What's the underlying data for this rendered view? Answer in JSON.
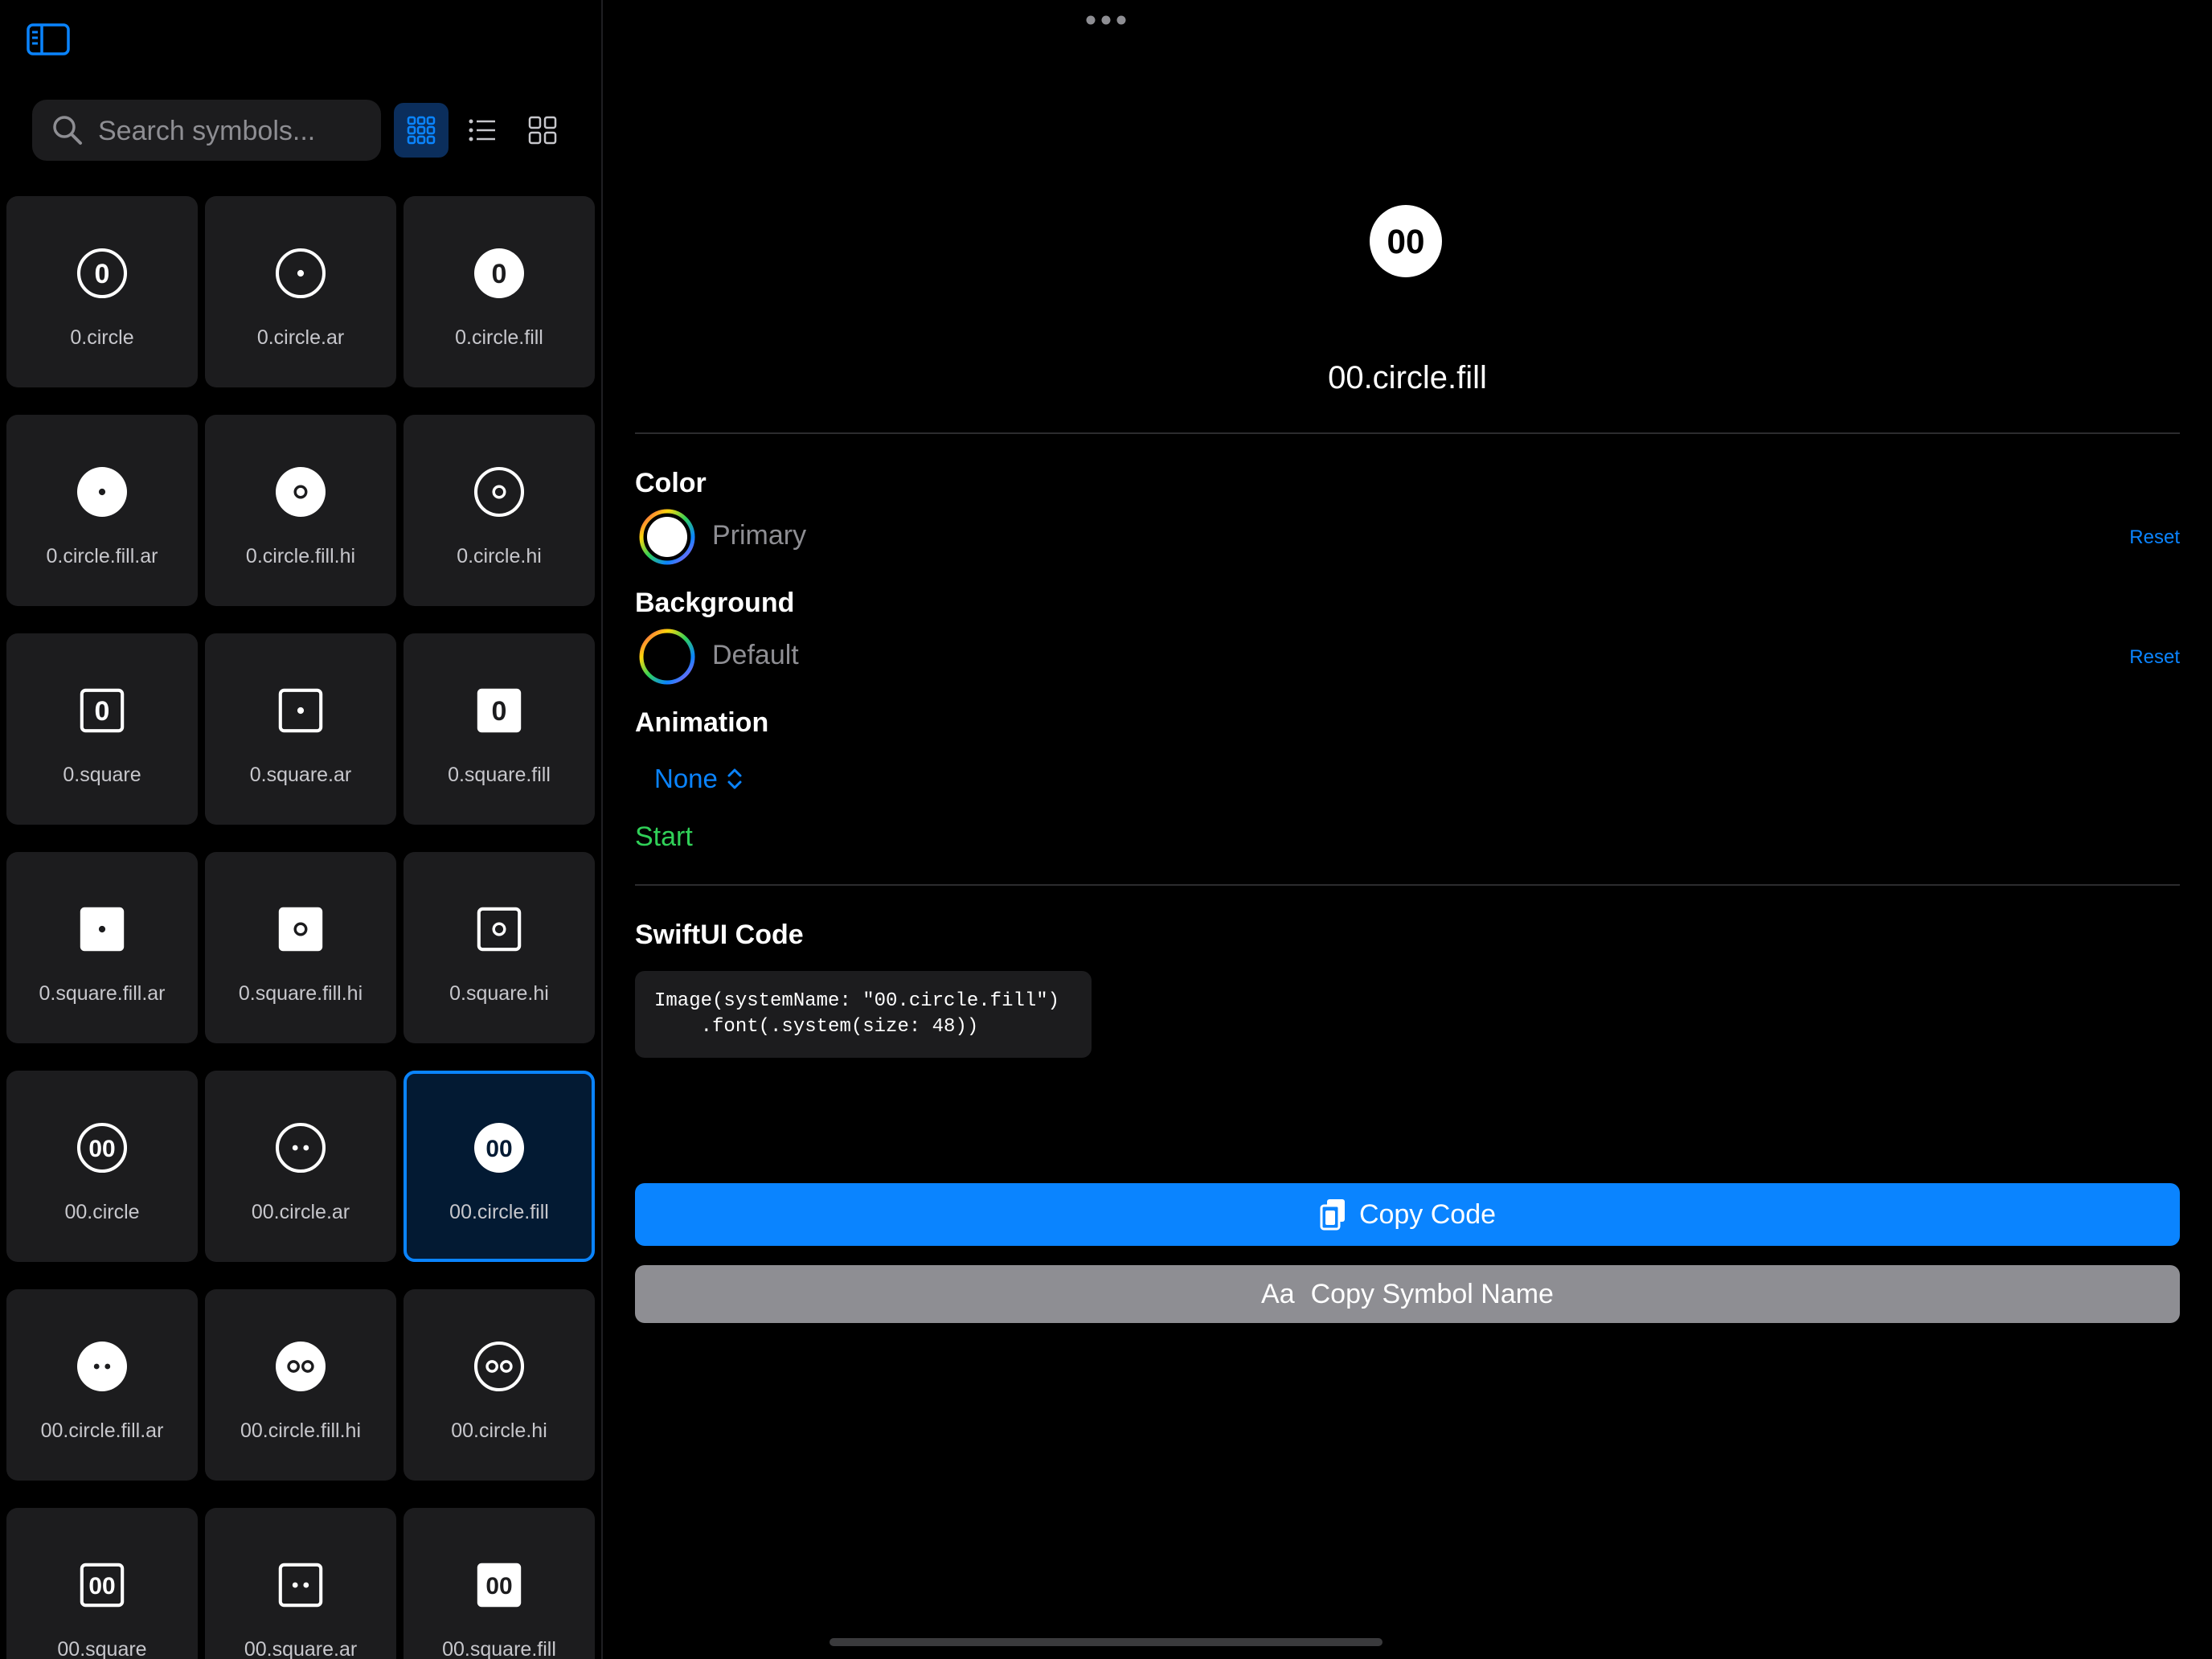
{
  "sidebar": {
    "toggle_icon": "sidebar-left-icon",
    "search": {
      "placeholder": "Search symbols...",
      "value": ""
    },
    "view_modes": [
      {
        "name": "small-grid",
        "icon": "grid-3x3-icon",
        "selected": true
      },
      {
        "name": "list",
        "icon": "list-bullet-icon",
        "selected": false
      },
      {
        "name": "large-grid",
        "icon": "grid-2x2-icon",
        "selected": false
      }
    ],
    "symbols": [
      {
        "name": "0.circle",
        "glyph": "0",
        "shape": "circle",
        "style": "outline"
      },
      {
        "name": "0.circle.ar",
        "glyph": "•",
        "shape": "circle",
        "style": "outline"
      },
      {
        "name": "0.circle.fill",
        "glyph": "0",
        "shape": "circle",
        "style": "fill"
      },
      {
        "name": "0.circle.fill.ar",
        "glyph": "•",
        "shape": "circle",
        "style": "fill"
      },
      {
        "name": "0.circle.fill.hi",
        "glyph": "o",
        "shape": "circle",
        "style": "fill"
      },
      {
        "name": "0.circle.hi",
        "glyph": "o",
        "shape": "circle",
        "style": "outline"
      },
      {
        "name": "0.square",
        "glyph": "0",
        "shape": "square",
        "style": "outline"
      },
      {
        "name": "0.square.ar",
        "glyph": "•",
        "shape": "square",
        "style": "outline"
      },
      {
        "name": "0.square.fill",
        "glyph": "0",
        "shape": "square",
        "style": "fill"
      },
      {
        "name": "0.square.fill.ar",
        "glyph": "•",
        "shape": "square",
        "style": "fill"
      },
      {
        "name": "0.square.fill.hi",
        "glyph": "o",
        "shape": "square",
        "style": "fill"
      },
      {
        "name": "0.square.hi",
        "glyph": "o",
        "shape": "square",
        "style": "outline"
      },
      {
        "name": "00.circle",
        "glyph": "00",
        "shape": "circle",
        "style": "outline"
      },
      {
        "name": "00.circle.ar",
        "glyph": "••",
        "shape": "circle",
        "style": "outline"
      },
      {
        "name": "00.circle.fill",
        "glyph": "00",
        "shape": "circle",
        "style": "fill",
        "selected": true
      },
      {
        "name": "00.circle.fill.ar",
        "glyph": "••",
        "shape": "circle",
        "style": "fill"
      },
      {
        "name": "00.circle.fill.hi",
        "glyph": "oo",
        "shape": "circle",
        "style": "fill"
      },
      {
        "name": "00.circle.hi",
        "glyph": "oo",
        "shape": "circle",
        "style": "outline"
      },
      {
        "name": "00.square",
        "glyph": "00",
        "shape": "square",
        "style": "outline"
      },
      {
        "name": "00.square.ar",
        "glyph": "••",
        "shape": "square",
        "style": "outline"
      },
      {
        "name": "00.square.fill",
        "glyph": "00",
        "shape": "square",
        "style": "fill"
      }
    ]
  },
  "detail": {
    "more_icon": "ellipsis-icon",
    "preview": {
      "glyph": "00",
      "shape": "circle",
      "style": "fill"
    },
    "symbol_name": "00.circle.fill",
    "color": {
      "title": "Color",
      "value": "Primary",
      "reset": "Reset"
    },
    "background": {
      "title": "Background",
      "value": "Default",
      "reset": "Reset"
    },
    "animation": {
      "title": "Animation",
      "value": "None",
      "start": "Start"
    },
    "code": {
      "title": "SwiftUI Code",
      "line1": "Image(systemName: \"00.circle.fill\")",
      "line2": "    .font(.system(size: 48))"
    },
    "copy_code_label": "Copy Code",
    "copy_name_label": "Copy Symbol Name",
    "copy_name_prefix": "Aa"
  },
  "colors": {
    "accent": "#0a84ff",
    "start": "#30d158",
    "tile": "#1c1c1e",
    "selected_tile": "#031a33",
    "secondary_button": "#8e8e93"
  }
}
